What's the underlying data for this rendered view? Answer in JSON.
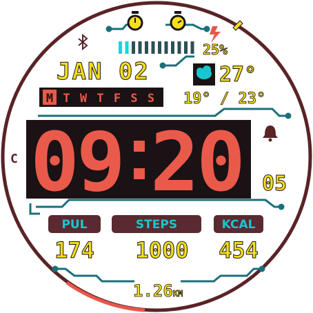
{
  "theme": {
    "accent_yellow": "#f3df1c",
    "accent_cyan": "#19c6cf",
    "digit_red": "#ea5a4a",
    "panel_dark": "#1a1214",
    "ring_color": "#5a2326",
    "pill_color": "#5a2a30",
    "battery_seg_color": "#2c5055",
    "battery_fill_color": "#18d5e0"
  },
  "status": {
    "battery_percent": "25%",
    "battery_level": 0.25,
    "icons": [
      "stopwatch-icon",
      "timer-icon",
      "bluetooth-icon",
      "charging-bolt-icon",
      "pencil-icon"
    ]
  },
  "date": {
    "month_day": "JAN 02",
    "weekdays": [
      "M",
      "T",
      "W",
      "T",
      "F",
      "S",
      "S"
    ],
    "active_day_index": 0
  },
  "weather": {
    "icon": "cloud-weather-icon",
    "temp": "27°",
    "range": "19° / 23°"
  },
  "time": {
    "hour": "09",
    "minute": "20",
    "seconds": "05",
    "alarm_icon": "bell-icon",
    "unit_letter": "C"
  },
  "metrics": [
    {
      "label": "PUL",
      "value": "174"
    },
    {
      "label": "STEPS",
      "value": "1000"
    },
    {
      "label": "KCAL",
      "value": "454"
    }
  ],
  "distance": {
    "value": "1.26",
    "unit": "KM"
  }
}
